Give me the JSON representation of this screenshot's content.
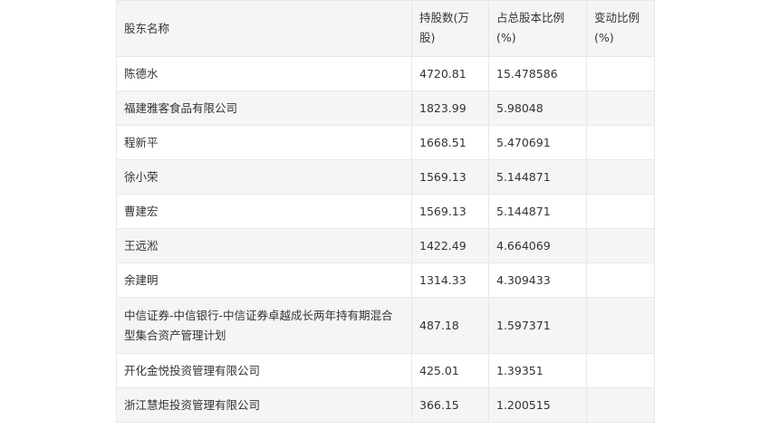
{
  "table": {
    "headers": {
      "name": "股东名称",
      "shares": "持股数(万股)",
      "ratio": "占总股本比例(%)",
      "change": "变动比例(%)"
    },
    "rows": [
      {
        "name": "陈德水",
        "shares": "4720.81",
        "ratio": "15.478586",
        "change": ""
      },
      {
        "name": "福建雅客食品有限公司",
        "shares": "1823.99",
        "ratio": "5.98048",
        "change": ""
      },
      {
        "name": "程新平",
        "shares": "1668.51",
        "ratio": "5.470691",
        "change": ""
      },
      {
        "name": "徐小荣",
        "shares": "1569.13",
        "ratio": "5.144871",
        "change": ""
      },
      {
        "name": "曹建宏",
        "shares": "1569.13",
        "ratio": "5.144871",
        "change": ""
      },
      {
        "name": "王远淞",
        "shares": "1422.49",
        "ratio": "4.664069",
        "change": ""
      },
      {
        "name": "余建明",
        "shares": "1314.33",
        "ratio": "4.309433",
        "change": ""
      },
      {
        "name": "中信证券-中信银行-中信证券卓越成长两年持有期混合型集合资产管理计划",
        "shares": "487.18",
        "ratio": "1.597371",
        "change": ""
      },
      {
        "name": "开化金悦投资管理有限公司",
        "shares": "425.01",
        "ratio": "1.39351",
        "change": ""
      },
      {
        "name": "浙江慧炬投资管理有限公司",
        "shares": "366.15",
        "ratio": "1.200515",
        "change": ""
      }
    ]
  }
}
